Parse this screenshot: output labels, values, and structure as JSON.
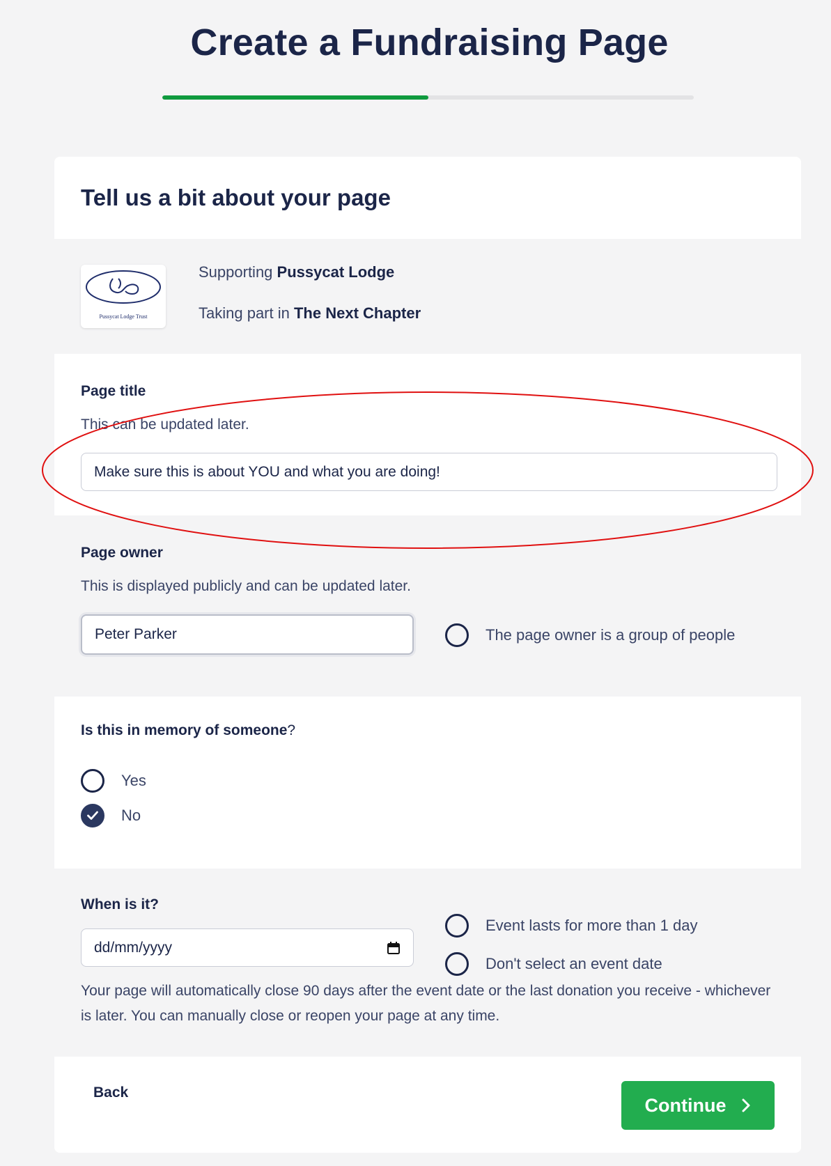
{
  "header": {
    "title": "Create a Fundraising Page",
    "progress_percent": 50
  },
  "card": {
    "heading": "Tell us a bit about your page",
    "support": {
      "logo_caption": "Pussycat Lodge Trust",
      "supporting_prefix": "Supporting",
      "supporting_name": "Pussycat Lodge",
      "event_prefix": "Taking part in",
      "event_name": "The Next Chapter"
    },
    "page_title": {
      "label": "Page title",
      "help": "This can be updated later.",
      "value": "Make sure this is about YOU and what you are doing!"
    },
    "page_owner": {
      "label": "Page owner",
      "help": "This is displayed publicly and can be updated later.",
      "value": "Peter Parker",
      "group_option": "The page owner is a group of people"
    },
    "memory": {
      "question": "Is this in memory of someone",
      "question_mark": "?",
      "options": [
        "Yes",
        "No"
      ],
      "selected": "No"
    },
    "event_date": {
      "label": "When is it?",
      "placeholder": "dd/mm/yyyy",
      "options": [
        "Event lasts for more than 1 day",
        "Don't select an event date"
      ],
      "note": "Your page will automatically close 90 days after the event date or the last donation you receive - whichever is later. You can manually close or reopen your page at any time."
    },
    "actions": {
      "back": "Back",
      "continue": "Continue"
    }
  },
  "colors": {
    "primary_text": "#1b2548",
    "progress_fill": "#0f9a3e",
    "continue_button": "#22ad4f",
    "annotation_ellipse": "#e01010"
  }
}
